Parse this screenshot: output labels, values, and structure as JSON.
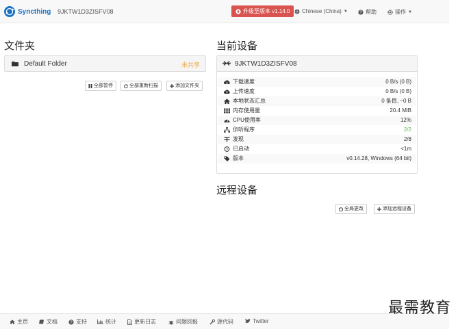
{
  "navbar": {
    "brand": "Syncthing",
    "device_id": "9JKTW1D3ZISFV08",
    "upgrade_label": "升级至版本 v1.14.0",
    "language_label": "Chinese (China)",
    "help_label": "帮助",
    "actions_label": "操作"
  },
  "folders": {
    "title": "文件夹",
    "items": [
      {
        "name": "Default Folder",
        "status": "未共享"
      }
    ],
    "buttons": {
      "pause_all": "全部暂停",
      "rescan_all": "全部重新扫描",
      "add_folder": "添加文件夹"
    }
  },
  "this_device": {
    "title": "当前设备",
    "name": "9JKTW1D3ZISFV08",
    "stats": [
      {
        "icon": "cloud-download-icon",
        "label": "下载速度",
        "value": "0 B/s (0 B)"
      },
      {
        "icon": "cloud-upload-icon",
        "label": "上传速度",
        "value": "0 B/s (0 B)"
      },
      {
        "icon": "home-icon",
        "label": "本地状态汇总",
        "value": "0 条目, ~0 B"
      },
      {
        "icon": "ram-icon",
        "label": "内存使用量",
        "value": "20.4 MiB"
      },
      {
        "icon": "dashboard-icon",
        "label": "CPU使用率",
        "value": "12%"
      },
      {
        "icon": "sitemap-icon",
        "label": "侦听程序",
        "value": "2/2"
      },
      {
        "icon": "discovery-icon",
        "label": "发现",
        "value": "2/8"
      },
      {
        "icon": "clock-icon",
        "label": "已启动",
        "value": "<1m"
      },
      {
        "icon": "tag-icon",
        "label": "版本",
        "value": "v0.14.28, Windows (64 bit)"
      }
    ]
  },
  "remote_devices": {
    "title": "远程设备",
    "buttons": {
      "recent_changes": "全局更改",
      "add_remote": "添加远程设备"
    }
  },
  "footer": {
    "links": [
      "主页",
      "文档",
      "支持",
      "统计",
      "更新日志",
      "问题回报",
      "源代码",
      "Twitter"
    ]
  },
  "watermark": "最需教育",
  "colors": {
    "brand": "#1b72c4",
    "upgrade": "#d9534f",
    "unshared": "#f0ad4e",
    "ok": "#5cb85c"
  }
}
